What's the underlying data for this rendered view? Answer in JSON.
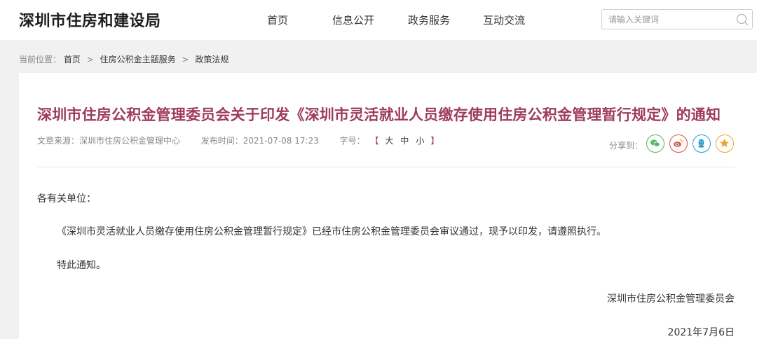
{
  "header": {
    "site_title": "深圳市住房和建设局",
    "nav": [
      "首页",
      "信息公开",
      "政务服务",
      "互动交流"
    ],
    "search": {
      "placeholder": "请输入关键词"
    }
  },
  "breadcrumb": {
    "label": "当前位置：",
    "items": [
      "首页",
      "住房公积金主题服务",
      "政策法规"
    ],
    "separator": ">"
  },
  "article": {
    "title": "深圳市住房公积金管理委员会关于印发《深圳市灵活就业人员缴存使用住房公积金管理暂行规定》的通知",
    "meta": {
      "source_label": "文章来源：",
      "source": "深圳市住房公积金管理中心",
      "time_label": "发布时间：",
      "time": "2021-07-08 17:23",
      "font_label": "字号：",
      "bracket_open": "【",
      "bracket_close": "】",
      "font_sizes": [
        "大",
        "中",
        "小"
      ]
    },
    "share": {
      "label": "分享到：",
      "icons": [
        "wechat-icon",
        "weibo-icon",
        "qq-icon",
        "favorite-icon"
      ]
    },
    "salutation": "各有关单位：",
    "paragraphs": [
      "《深圳市灵活就业人员缴存使用住房公积金管理暂行规定》已经市住房公积金管理委员会审议通过，现予以印发，请遵照执行。",
      "特此通知。"
    ],
    "signer": "深圳市住房公积金管理委员会",
    "sign_date": "2021年7月6日"
  },
  "colors": {
    "title": "#9e3c59",
    "background": "#f1f1f1",
    "wechat": "#4fb95b",
    "weibo": "#e1523d",
    "qq": "#1ea0e0",
    "favorite": "#f0a224"
  }
}
